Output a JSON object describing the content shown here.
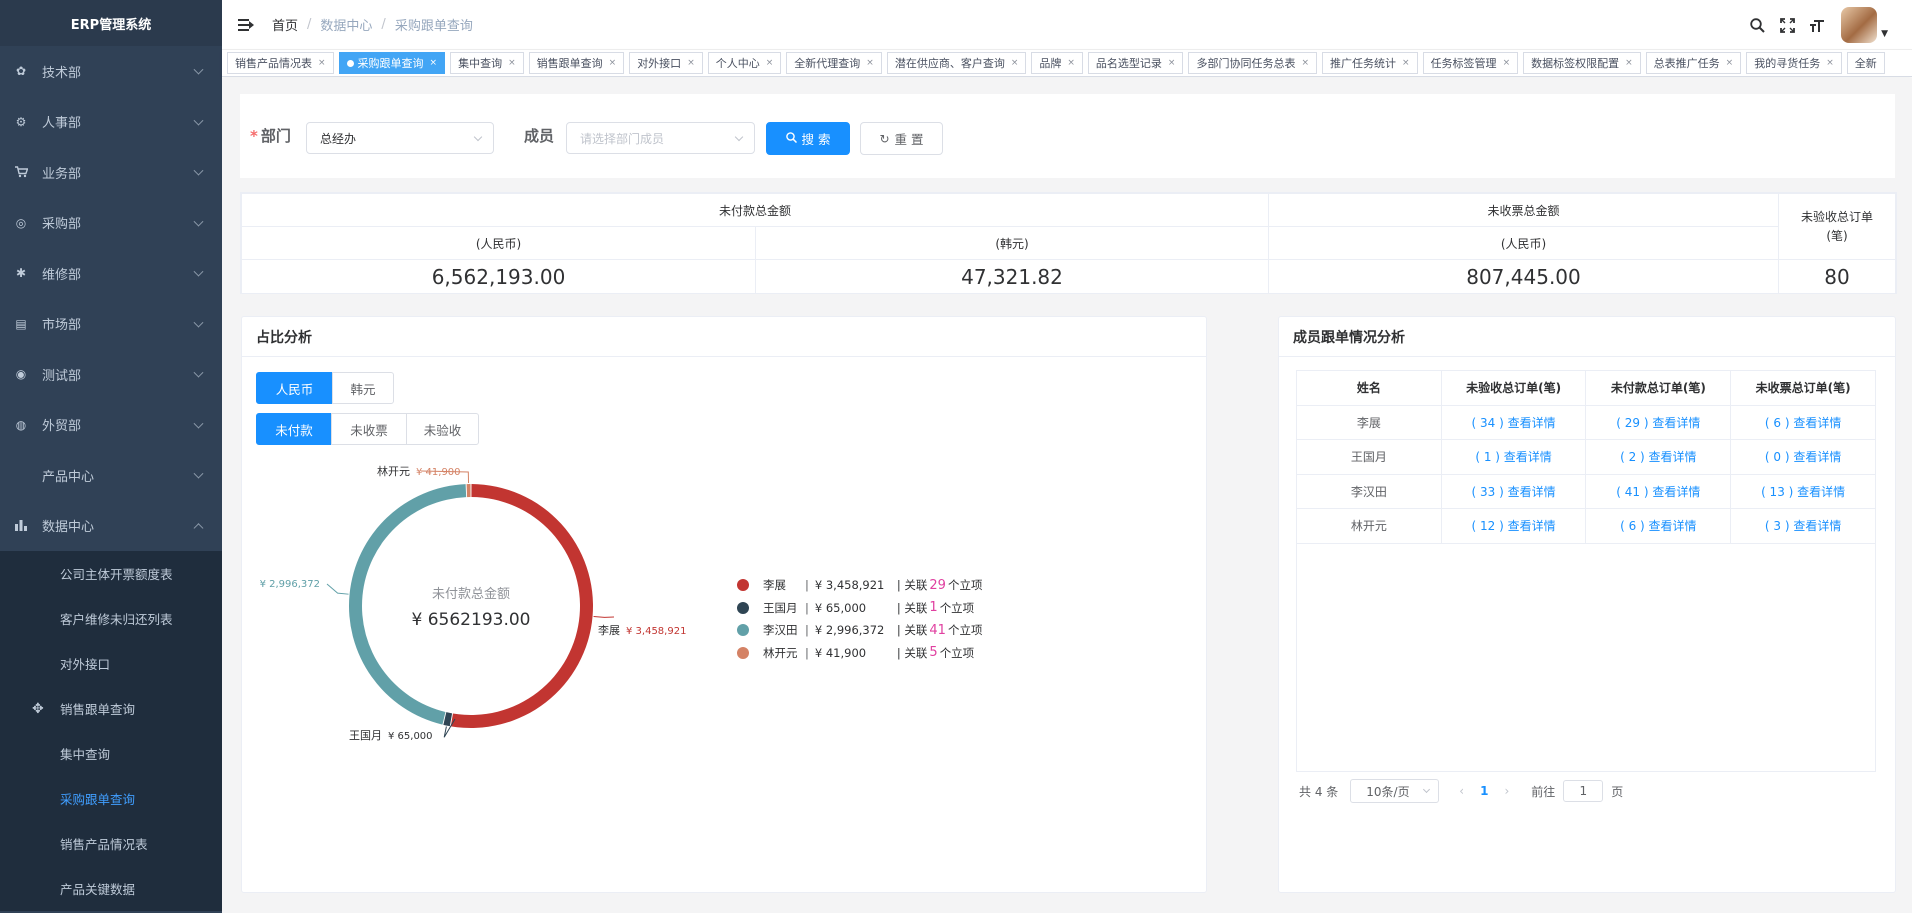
{
  "app": {
    "title": "ERP管理系统"
  },
  "sidebar": {
    "items": [
      {
        "label": "技术部",
        "icon": "gear-icon"
      },
      {
        "label": "人事部",
        "icon": "settings-icon"
      },
      {
        "label": "业务部",
        "icon": "cart-icon"
      },
      {
        "label": "采购部",
        "icon": "compass-icon"
      },
      {
        "label": "维修部",
        "icon": "bug-icon"
      },
      {
        "label": "市场部",
        "icon": "monitor-icon"
      },
      {
        "label": "测试部",
        "icon": "dashboard-icon"
      },
      {
        "label": "外贸部",
        "icon": "globe-icon"
      },
      {
        "label": "产品中心",
        "icon": ""
      },
      {
        "label": "数据中心",
        "icon": "bar-chart-icon"
      }
    ],
    "sub_items": [
      {
        "label": "公司主体开票额度表"
      },
      {
        "label": "客户维修未归还列表"
      },
      {
        "label": "对外接口"
      },
      {
        "label": "销售跟单查询"
      },
      {
        "label": "集中查询"
      },
      {
        "label": "采购跟单查询"
      },
      {
        "label": "销售产品情况表"
      },
      {
        "label": "产品关键数据"
      }
    ]
  },
  "breadcrumb": [
    "首页",
    "数据中心",
    "采购跟单查询"
  ],
  "tags": [
    "销售产品情况表",
    "采购跟单查询",
    "集中查询",
    "销售跟单查询",
    "对外接口",
    "个人中心",
    "全新代理查询",
    "潜在供应商、客户查询",
    "品牌",
    "品名选型记录",
    "多部门协同任务总表",
    "推广任务统计",
    "任务标签管理",
    "数据标签权限配置",
    "总表推广任务",
    "我的寻货任务",
    "全新"
  ],
  "search": {
    "dept_label": "部门",
    "dept_value": "总经办",
    "member_label": "成员",
    "member_placeholder": "请选择部门成员",
    "search_btn": "搜 索",
    "reset_btn": "重 置"
  },
  "summary": {
    "unpaid_title": "未付款总金额",
    "uninvoiced_title": "未收票总金额",
    "unaccepted_title": "未验收总订单",
    "unaccepted_unit": "(笔)",
    "rmb": "(人民币)",
    "krw": "(韩元)",
    "unpaid_rmb": "6,562,193.00",
    "unpaid_krw": "47,321.82",
    "uninvoiced_rmb": "807,445.00",
    "unaccepted_count": "80"
  },
  "ratio": {
    "title": "占比分析",
    "currency_tabs": [
      "人民币",
      "韩元"
    ],
    "type_tabs": [
      "未付款",
      "未收票",
      "未验收"
    ],
    "center_label": "未付款总金额",
    "center_value": "¥ 6562193.00",
    "colors": [
      "#c23531",
      "#2f4554",
      "#61a0a8",
      "#d48265"
    ],
    "legend": [
      {
        "name": "李展",
        "amount": "¥ 3,458,921",
        "prefix": "| 关联",
        "count": "29",
        "suffix": "个立项"
      },
      {
        "name": "王国月",
        "amount": "¥ 65,000",
        "prefix": "| 关联",
        "count": "1",
        "suffix": "个立项"
      },
      {
        "name": "李汉田",
        "amount": "¥ 2,996,372",
        "prefix": "| 关联",
        "count": "41",
        "suffix": "个立项"
      },
      {
        "name": "林开元",
        "amount": "¥ 41,900",
        "prefix": "| 关联",
        "count": "5",
        "suffix": "个立项"
      }
    ],
    "labels": {
      "lz_name": "李展",
      "lz_amt": "¥ 3,458,921",
      "wgy_name": "王国月",
      "wgy_amt": "¥ 65,000",
      "lht_amt": "¥ 2,996,372",
      "lky_name": "林开元",
      "lky_amt": "¥ 41,900"
    }
  },
  "chart_data": {
    "type": "pie",
    "categories": [
      "李展",
      "王国月",
      "李汉田",
      "林开元"
    ],
    "values": [
      3458921,
      65000,
      2996372,
      41900
    ]
  },
  "members": {
    "title": "成员跟单情况分析",
    "headers": [
      "姓名",
      "未验收总订单(笔)",
      "未付款总订单(笔)",
      "未收票总订单(笔)"
    ],
    "rows": [
      {
        "name": "李展",
        "a": "( 34 ) 查看详情",
        "b": "( 29 ) 查看详情",
        "c": "( 6 ) 查看详情"
      },
      {
        "name": "王国月",
        "a": "( 1 ) 查看详情",
        "b": "( 2 ) 查看详情",
        "c": "( 0 ) 查看详情"
      },
      {
        "name": "李汉田",
        "a": "( 33 ) 查看详情",
        "b": "( 41 ) 查看详情",
        "c": "( 13 ) 查看详情"
      },
      {
        "name": "林开元",
        "a": "( 12 ) 查看详情",
        "b": "( 6 ) 查看详情",
        "c": "( 3 ) 查看详情"
      }
    ],
    "total": "共 4 条",
    "page_size": "10条/页",
    "page": "1",
    "goto_label": "前往",
    "goto_value": "1",
    "page_unit": "页"
  }
}
